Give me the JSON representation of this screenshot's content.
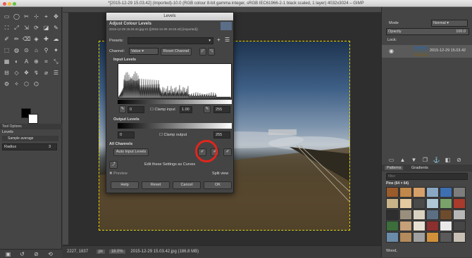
{
  "window": {
    "title": "*[2015-12-29 15.03.42] (imported)-10.0 (RGB colour 8-bit gamma integer, sRGB IEC61966-2-1 black scaled, 1 layer) 4032x3024 – GIMP"
  },
  "toolbox": {
    "tool_options_tab": "Tool Options",
    "layers_label": "Levels",
    "sample_average": "Sample average",
    "radius_label": "Radius",
    "radius_value": "3"
  },
  "status": {
    "coords": "2227, 1837",
    "unit": "px",
    "zoom": "18.0%",
    "file": "2015-12-29 15.03.42.jpg (186.8 MB)"
  },
  "right": {
    "mode_label": "Mode",
    "mode_value": "Normal",
    "opacity_label": "Opacity",
    "opacity_value": "100.0",
    "lock_label": "Lock:",
    "layer_name": "2015-12-29 15.03.42",
    "patterns_tab": "Patterns",
    "gradients_tab": "Gradients",
    "filter_placeholder": "filter",
    "pattern_name": "Pine (64 × 64)",
    "bottom_pattern": "Wood,"
  },
  "dialog": {
    "window_title": "Levels",
    "heading": "Adjust Colour Levels",
    "subheading": "2015-12-29 15.03.42.jpg-21 ([2015-12-29 15.03.42] (imported))",
    "presets_label": "Presets:",
    "channel_label": "Channel:",
    "channel_value": "Value",
    "reset_channel": "Reset Channel",
    "input_levels": "Input Levels",
    "input_low": "0",
    "clamp_input": "Clamp input",
    "gamma": "1.00",
    "input_high": "255",
    "output_levels": "Output Levels",
    "output_low": "0",
    "clamp_output": "Clamp output",
    "output_high": "255",
    "all_channels": "All Channels",
    "auto_input": "Auto Input Levels",
    "edit_curves": "Edit these Settings as Curves",
    "preview": "Preview",
    "split_view": "Split view",
    "help": "Help",
    "reset": "Reset",
    "cancel": "Cancel",
    "ok": "OK"
  },
  "colors": {
    "accent_highlight": "#e0261b",
    "selection": "#e6d200"
  }
}
